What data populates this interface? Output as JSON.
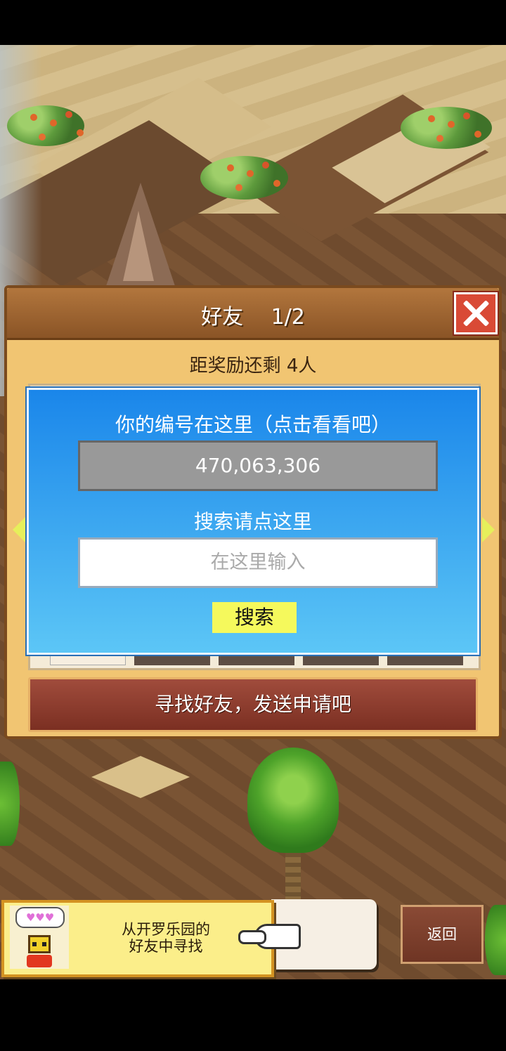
{
  "panel": {
    "title": "好友　 1/2",
    "reward_text": "距奖励还剩 4人",
    "find_button": "寻找好友，发送申请吧"
  },
  "dialog": {
    "id_label": "你的编号在这里（点击看看吧）",
    "id_value": "470,063,306",
    "search_label": "搜索请点这里",
    "search_placeholder": "在这里输入",
    "search_button": "搜索"
  },
  "banner": {
    "hearts": "♥♥♥",
    "line1": "从开罗乐园的",
    "line2": "好友中寻找"
  },
  "back_button": "返回",
  "colors": {
    "dialog_top": "#1a86ea",
    "dialog_bottom": "#5cc6f6",
    "panel_bg": "#f1c572",
    "search_button": "#f5f95c",
    "close_button": "#d94a36"
  },
  "icons": [
    "close-icon",
    "arrow-left-icon",
    "arrow-right-icon",
    "pointing-hand-icon",
    "robot-avatar-icon"
  ]
}
